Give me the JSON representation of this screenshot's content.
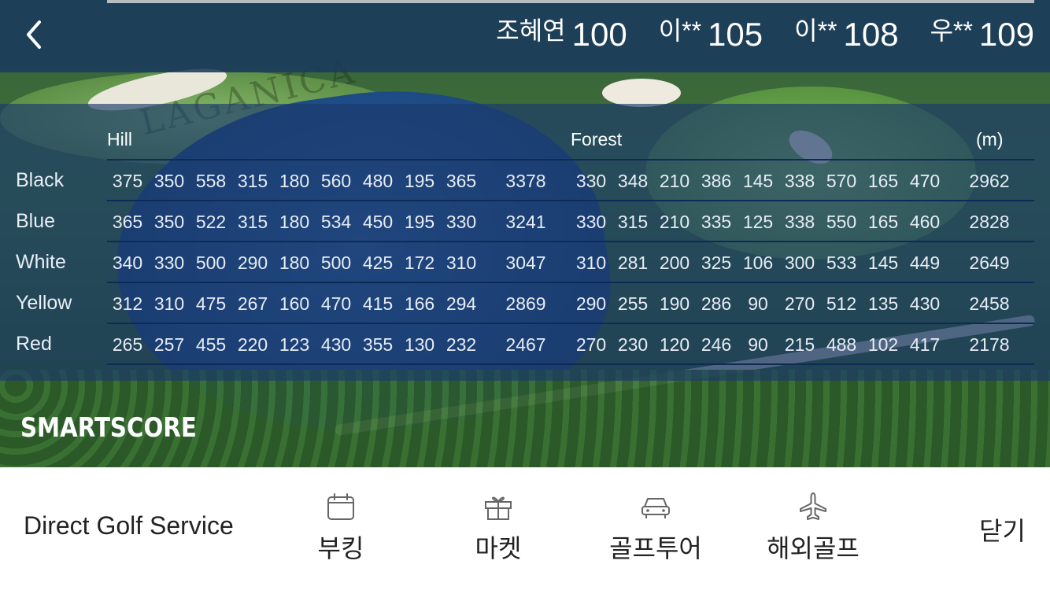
{
  "header": {
    "players": [
      {
        "name": "조혜연",
        "score": "100"
      },
      {
        "name": "이**",
        "score": "105"
      },
      {
        "name": "이**",
        "score": "108"
      },
      {
        "name": "우**",
        "score": "109"
      }
    ]
  },
  "scorecard": {
    "sections": {
      "first": "Hill",
      "second": "Forest",
      "unit": "(m)"
    },
    "rows": [
      {
        "tee": "Black",
        "hill": [
          "375",
          "350",
          "558",
          "315",
          "180",
          "560",
          "480",
          "195",
          "365"
        ],
        "hill_total": "3378",
        "forest": [
          "330",
          "348",
          "210",
          "386",
          "145",
          "338",
          "570",
          "165",
          "470"
        ],
        "forest_total": "2962"
      },
      {
        "tee": "Blue",
        "hill": [
          "365",
          "350",
          "522",
          "315",
          "180",
          "534",
          "450",
          "195",
          "330"
        ],
        "hill_total": "3241",
        "forest": [
          "330",
          "315",
          "210",
          "335",
          "125",
          "338",
          "550",
          "165",
          "460"
        ],
        "forest_total": "2828"
      },
      {
        "tee": "White",
        "hill": [
          "340",
          "330",
          "500",
          "290",
          "180",
          "500",
          "425",
          "172",
          "310"
        ],
        "hill_total": "3047",
        "forest": [
          "310",
          "281",
          "200",
          "325",
          "106",
          "300",
          "533",
          "145",
          "449"
        ],
        "forest_total": "2649"
      },
      {
        "tee": "Yellow",
        "hill": [
          "312",
          "310",
          "475",
          "267",
          "160",
          "470",
          "415",
          "166",
          "294"
        ],
        "hill_total": "2869",
        "forest": [
          "290",
          "255",
          "190",
          "286",
          "90",
          "270",
          "512",
          "135",
          "430"
        ],
        "forest_total": "2458"
      },
      {
        "tee": "Red",
        "hill": [
          "265",
          "257",
          "455",
          "220",
          "123",
          "430",
          "355",
          "130",
          "232"
        ],
        "hill_total": "2467",
        "forest": [
          "270",
          "230",
          "120",
          "246",
          "90",
          "215",
          "488",
          "102",
          "417"
        ],
        "forest_total": "2178"
      }
    ]
  },
  "background": {
    "watermark": "LAGANICA",
    "logo": "SMARTSCORE"
  },
  "bottom_bar": {
    "title": "Direct Golf Service",
    "items": [
      {
        "label": "부킹",
        "icon": "calendar-icon"
      },
      {
        "label": "마켓",
        "icon": "gift-icon"
      },
      {
        "label": "골프투어",
        "icon": "car-icon"
      },
      {
        "label": "해외골프",
        "icon": "airplane-icon"
      }
    ],
    "close_label": "닫기"
  }
}
